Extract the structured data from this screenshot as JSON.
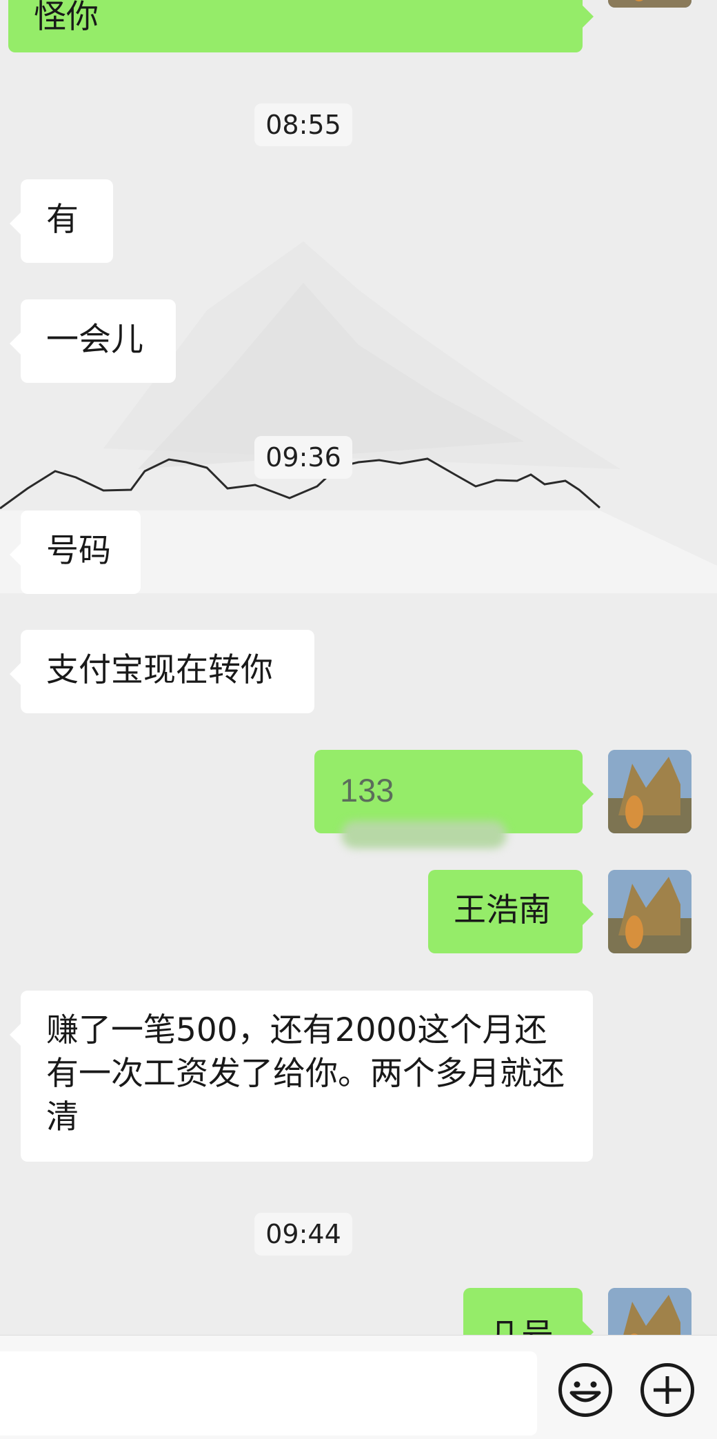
{
  "messages": [
    {
      "text": "怪你"
    },
    {
      "time": "08:55"
    },
    {
      "text": "有"
    },
    {
      "text": "一会儿"
    },
    {
      "time": "09:36"
    },
    {
      "text": "号码"
    },
    {
      "text": "支付宝现在转你"
    },
    {
      "text": "133"
    },
    {
      "text": "王浩南"
    },
    {
      "text": "赚了一笔500，还有2000这个月还有一次工资发了给你。两个多月就还清"
    },
    {
      "time": "09:44"
    },
    {
      "text": "几号"
    }
  ],
  "input": {
    "placeholder": ""
  },
  "icons": {
    "emoji": "emoji-icon",
    "add": "plus-icon"
  },
  "colors": {
    "background": "#ededed",
    "sent_bubble": "#95ec69",
    "received_bubble": "#ffffff"
  }
}
